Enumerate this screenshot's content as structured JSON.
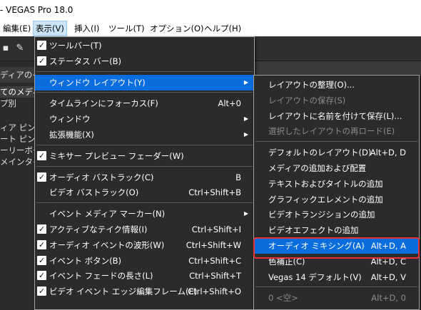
{
  "window": {
    "title": "- VEGAS Pro 18.0"
  },
  "menubar": [
    {
      "label": "編集(E)",
      "active": false
    },
    {
      "label": "表示(V)",
      "active": true
    },
    {
      "label": "挿入(I)",
      "active": false
    },
    {
      "label": "ツール(T)",
      "active": false
    },
    {
      "label": "オプション(O)",
      "active": false
    },
    {
      "label": "ヘルプ(H)",
      "active": false
    }
  ],
  "left_pane": {
    "header": "ディアのイン",
    "items": [
      "てのメディア",
      "プ別",
      "ィア ピン",
      "ート ピン",
      "ーリーボー",
      "メインタイム"
    ]
  },
  "view_menu": [
    {
      "label": "ツールバー(T)",
      "checked": true
    },
    {
      "label": "ステータス バー(B)",
      "checked": true
    },
    {
      "sep": true
    },
    {
      "label": "ウィンドウ レイアウト(Y)",
      "submenu": true,
      "highlight": true
    },
    {
      "sep": true
    },
    {
      "label": "タイムラインにフォーカス(F)",
      "shortcut": "Alt+0"
    },
    {
      "label": "ウィンドウ",
      "submenu": true
    },
    {
      "label": "拡張機能(X)",
      "submenu": true
    },
    {
      "sep": true
    },
    {
      "label": "ミキサー プレビュー フェーダー(W)",
      "checked": true
    },
    {
      "sep": true
    },
    {
      "label": "オーディオ バストラック(C)",
      "checked": true,
      "shortcut": "B"
    },
    {
      "label": "ビデオ バストラック(O)",
      "shortcut": "Ctrl+Shift+B"
    },
    {
      "sep": true
    },
    {
      "label": "イベント メディア マーカー(N)",
      "submenu": true
    },
    {
      "label": "アクティブなテイク情報(I)",
      "checked": true,
      "shortcut": "Ctrl+Shift+I"
    },
    {
      "label": "オーディオ イベントの波形(W)",
      "checked": true,
      "shortcut": "Ctrl+Shift+W"
    },
    {
      "label": "イベント ボタン(B)",
      "checked": true,
      "shortcut": "Ctrl+Shift+C"
    },
    {
      "label": "イベント フェードの長さ(L)",
      "checked": true,
      "shortcut": "Ctrl+Shift+T"
    },
    {
      "label": "ビデオ イベント エッジ編集フレーム(E)",
      "checked": true,
      "shortcut": "Ctrl+Shift+O"
    }
  ],
  "layout_submenu": [
    {
      "label": "レイアウトの整理(O)..."
    },
    {
      "label": "レイアウトの保存(S)",
      "disabled": true
    },
    {
      "label": "レイアウトに名前を付けて保存(L)..."
    },
    {
      "label": "選択したレイアウトの再ロード(E)",
      "disabled": true
    },
    {
      "sep": true
    },
    {
      "label": "デフォルトのレイアウト(D)",
      "shortcut": "Alt+D, D"
    },
    {
      "label": "メディアの追加および配置"
    },
    {
      "label": "テキストおよびタイトルの追加"
    },
    {
      "label": "グラフィックエレメントの追加"
    },
    {
      "label": "ビデオトランジションの追加"
    },
    {
      "label": "ビデオエフェクトの追加"
    },
    {
      "label": "オーディオ ミキシング(A)",
      "shortcut": "Alt+D, A",
      "highlight": true
    },
    {
      "label": "色補正(C)",
      "shortcut": "Alt+D, C"
    },
    {
      "label": "Vegas 14 デフォルト(V)",
      "shortcut": "Alt+D, V"
    },
    {
      "sep": true
    },
    {
      "label": "0 <空>",
      "shortcut": "Alt+D, 0",
      "disabled": true
    }
  ],
  "colors": {
    "highlight": "#0a6ddd",
    "menu_bg": "#2b2b2b",
    "annotation": "#e8333a"
  }
}
